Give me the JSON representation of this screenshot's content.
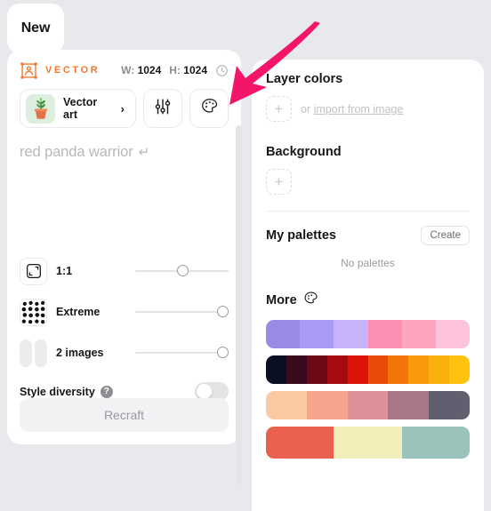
{
  "tab": {
    "label": "New"
  },
  "left_panel": {
    "model": {
      "icon": "vector-image-icon",
      "label": "VECTOR",
      "color": "#f4762c"
    },
    "size": {
      "width_key": "W:",
      "width_value": "1024",
      "height_key": "H:",
      "height_value": "1024",
      "history_icon": "clock-icon"
    },
    "style": {
      "thumbnail": "potted-plant-image",
      "name": "Vector art",
      "chevron": "›"
    },
    "buttons": {
      "settings_icon": "sliders-icon",
      "palette_icon": "palette-icon"
    },
    "prompt": {
      "placeholder": "red panda warrior",
      "submit_icon": "↵"
    },
    "controls": [
      {
        "icon": "aspect-ratio-icon",
        "label": "1:1",
        "slider_percent": 45
      },
      {
        "icon": "detail-dots-icon",
        "label": "Extreme",
        "slider_percent": 100
      },
      {
        "icon": "image-count-icon",
        "label": "2 images",
        "slider_percent": 100
      }
    ],
    "style_diversity": {
      "label": "Style diversity",
      "help_icon": "?",
      "enabled": false
    },
    "submit": {
      "label": "Recraft"
    }
  },
  "right_panel": {
    "layer_colors": {
      "title": "Layer colors",
      "add_icon": "+",
      "or_text": "or",
      "import_link": "import from image"
    },
    "background": {
      "title": "Background",
      "add_icon": "+"
    },
    "my_palettes": {
      "title": "My palettes",
      "create_label": "Create",
      "empty_text": "No palettes"
    },
    "more": {
      "title": "More",
      "icon": "palette-icon"
    },
    "palettes": [
      {
        "name": "purple-pink",
        "colors": [
          "#9b8ae4",
          "#a79bf5",
          "#c9b4fb",
          "#fd8fb4",
          "#fda5bf",
          "#fdc3dd"
        ]
      },
      {
        "name": "dark-fire",
        "colors": [
          "#0b0f24",
          "#3a0b1d",
          "#6b0a16",
          "#a50c10",
          "#dc1406",
          "#ec4a08",
          "#f0760a",
          "#f89a0c",
          "#fbb00d",
          "#ffc20e"
        ]
      },
      {
        "name": "peach-slate",
        "colors": [
          "#fbcaa4",
          "#f7a48d",
          "#de8f97",
          "#a97788",
          "#605e6f"
        ]
      },
      {
        "name": "coral-teal",
        "colors": [
          "#e9604f",
          "#f2eeba",
          "#9ac3bb"
        ]
      }
    ]
  },
  "annotation": {
    "arrow_color": "#f4156a",
    "points_to": "palette-icon-button"
  }
}
